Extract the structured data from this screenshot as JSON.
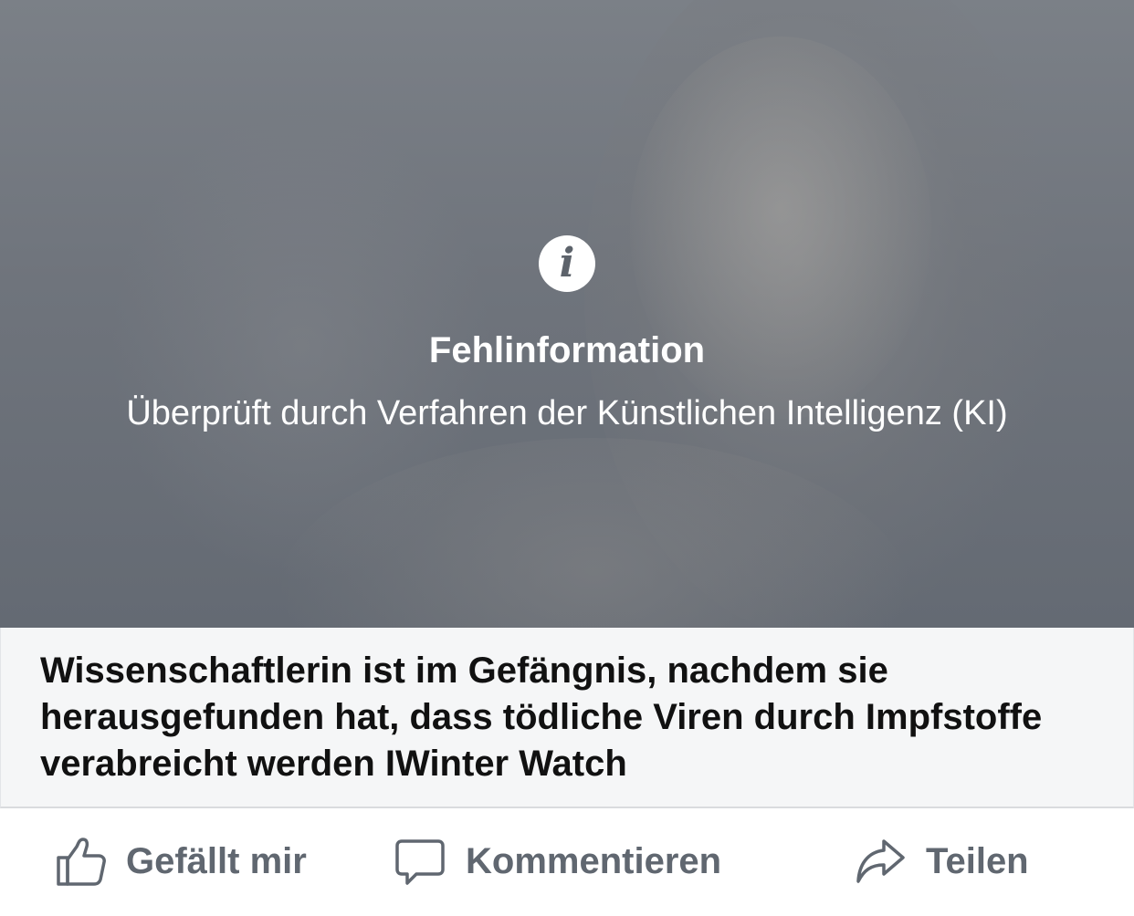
{
  "warning": {
    "icon": "info-icon",
    "title": "Fehlinformation",
    "subtitle": "Überprüft durch Verfahren der Künstlichen Intelligenz (KI)"
  },
  "link": {
    "headline": "Wissenschaftlerin ist im Gefängnis, nachdem sie herausgefunden hat, dass tödliche Viren durch Impfstoffe verabreicht werden IWinter Watch"
  },
  "actions": {
    "like_label": "Gefällt mir",
    "comment_label": "Kommentieren",
    "share_label": "Teilen"
  },
  "colors": {
    "overlay": "#6b7078",
    "link_background": "#f5f6f7",
    "action_text": "#606770"
  }
}
